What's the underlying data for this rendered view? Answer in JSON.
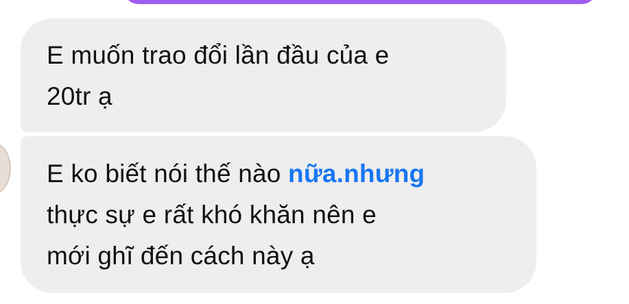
{
  "messages": [
    {
      "lines": [
        "E muốn trao đổi lần đầu của e",
        "20tr ạ"
      ]
    },
    {
      "line1_text": "E ko biết nói thế nào ",
      "line1_highlight": "nữa.nhưng",
      "line2": "thực sự e rất khó khăn nên e",
      "line3": "mới ghĩ đến cách này ạ"
    }
  ],
  "colors": {
    "incoming_bubble": "#eeeeee",
    "outgoing_bubble": "#a15cf0",
    "highlight_text": "#1877f2"
  }
}
